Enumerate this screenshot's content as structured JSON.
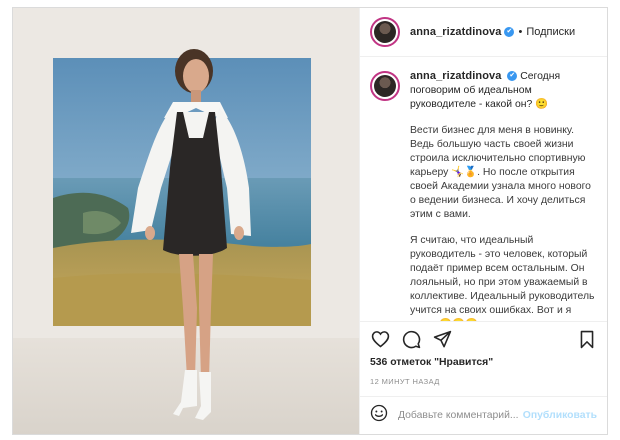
{
  "author": {
    "username": "anna_rizatdinova",
    "verified_mark": "✔",
    "follow_separator": "•",
    "follow_label": "Подписки"
  },
  "caption": {
    "username": "anna_rizatdinova",
    "verified_mark": "✔",
    "lead": "Сегодня поговорим об идеальном руководителе - какой он? 🙂",
    "paragraph_2": "Вести бизнес для меня в новинку. Ведь большую часть своей жизни строила исключительно спортивную карьеру 🤸‍♀️🏅. Но после открытия своей Академии узнала много нового о ведении бизнеса. И хочу делиться этим с вами.",
    "paragraph_3": "Я считаю, что идеальный руководитель - это человек, который подаёт пример всем остальным. Он лояльный, но при этом уважаемый в коллективе. Идеальный руководитель учится на своих ошибках. Вот и я учусь 🙂🙂🙂"
  },
  "actions": {
    "like_icon": "heart-icon",
    "comment_icon": "comment-icon",
    "share_icon": "share-icon",
    "save_icon": "bookmark-icon"
  },
  "likes": {
    "text": "536 отметок \"Нравится\""
  },
  "timestamp": "12 МИНУТ НАЗАД",
  "comment_box": {
    "emoji_icon": "smiley-icon",
    "placeholder": "Добавьте комментарий...",
    "post_label": "Опубликовать"
  },
  "colors": {
    "verified": "#3897f0",
    "post_disabled": "#b2dffc",
    "story_ring": "#c13584",
    "muted": "#8e8e8e"
  }
}
